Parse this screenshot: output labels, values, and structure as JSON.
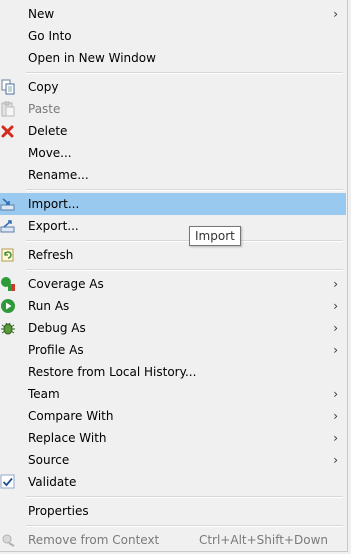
{
  "menu": {
    "items": [
      {
        "label": "New",
        "submenu": true
      },
      {
        "label": "Go Into"
      },
      {
        "label": "Open in New Window"
      },
      {
        "label": "Copy",
        "icon": "copy-icon"
      },
      {
        "label": "Paste",
        "icon": "paste-icon",
        "disabled": true
      },
      {
        "label": "Delete",
        "icon": "delete-icon"
      },
      {
        "label": "Move..."
      },
      {
        "label": "Rename..."
      },
      {
        "label": "Import...",
        "icon": "import-icon",
        "highlighted": true
      },
      {
        "label": "Export...",
        "icon": "export-icon"
      },
      {
        "label": "Refresh",
        "icon": "refresh-icon"
      },
      {
        "label": "Coverage As",
        "icon": "coverage-icon",
        "submenu": true
      },
      {
        "label": "Run As",
        "icon": "run-icon",
        "submenu": true
      },
      {
        "label": "Debug As",
        "icon": "debug-icon",
        "submenu": true
      },
      {
        "label": "Profile As",
        "submenu": true
      },
      {
        "label": "Restore from Local History..."
      },
      {
        "label": "Team",
        "submenu": true
      },
      {
        "label": "Compare With",
        "submenu": true
      },
      {
        "label": "Replace With",
        "submenu": true
      },
      {
        "label": "Source",
        "submenu": true
      },
      {
        "label": "Validate",
        "icon": "checkmark-icon"
      },
      {
        "label": "Properties"
      },
      {
        "label": "Remove from Context",
        "icon": "remove-context-icon",
        "disabled": true,
        "shortcut": "Ctrl+Alt+Shift+Down"
      }
    ],
    "submenu_arrow": "›"
  },
  "tooltip": {
    "text": "Import"
  },
  "colors": {
    "highlight": "#99c9ef",
    "menu_bg": "#f0f0f0",
    "disabled_text": "#7a7a7a"
  }
}
